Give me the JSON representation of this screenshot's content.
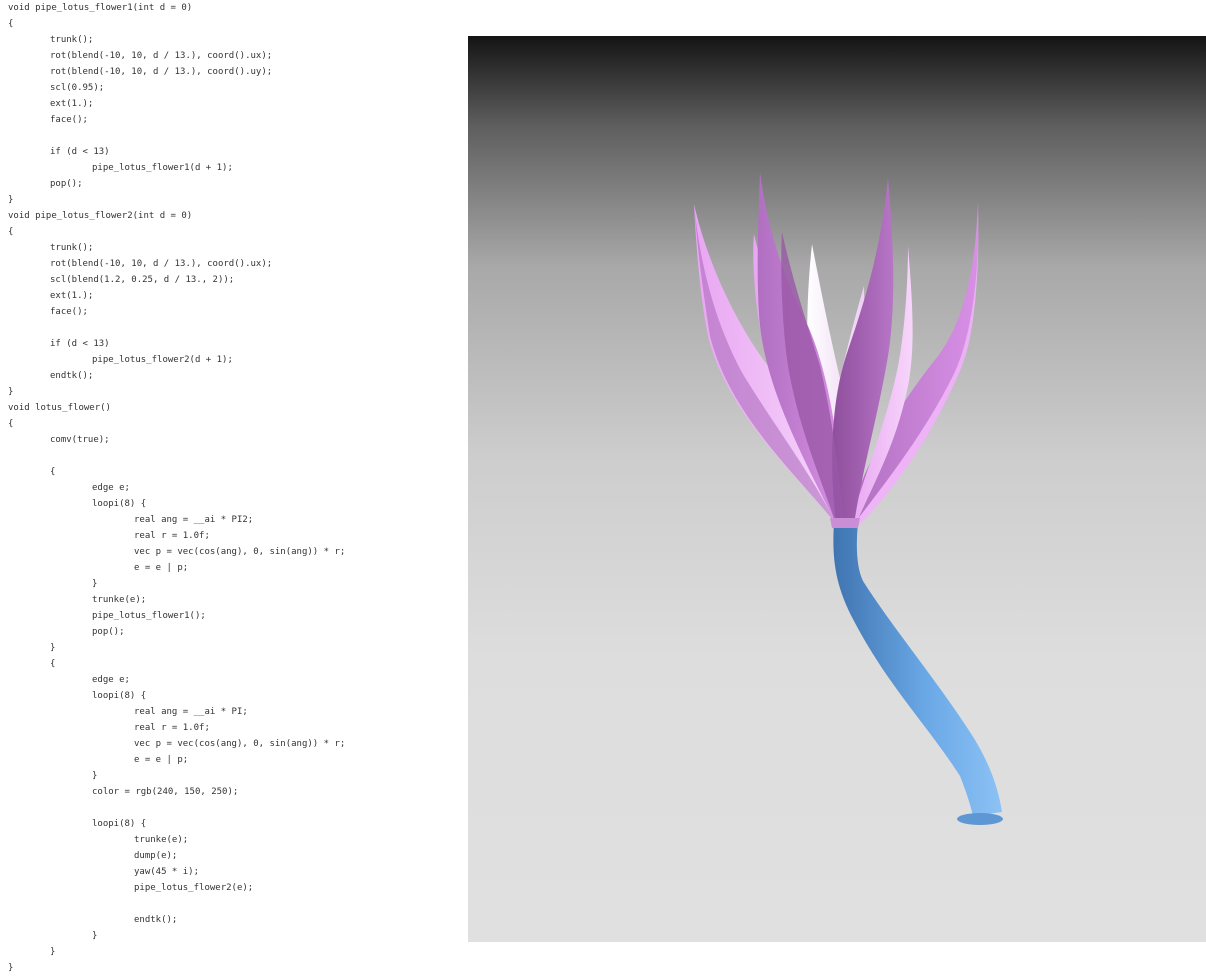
{
  "code_lines": [
    {
      "indent": 0,
      "text": "void pipe_lotus_flower1(int d = 0)"
    },
    {
      "indent": 0,
      "text": "{"
    },
    {
      "indent": 1,
      "text": "trunk();"
    },
    {
      "indent": 1,
      "text": "rot(blend(-10, 10, d / 13.), coord().ux);"
    },
    {
      "indent": 1,
      "text": "rot(blend(-10, 10, d / 13.), coord().uy);"
    },
    {
      "indent": 1,
      "text": "scl(0.95);"
    },
    {
      "indent": 1,
      "text": "ext(1.);"
    },
    {
      "indent": 1,
      "text": "face();"
    },
    {
      "indent": 1,
      "text": ""
    },
    {
      "indent": 1,
      "text": "if (d < 13)"
    },
    {
      "indent": 2,
      "text": "pipe_lotus_flower1(d + 1);"
    },
    {
      "indent": 1,
      "text": "pop();"
    },
    {
      "indent": 0,
      "text": "}"
    },
    {
      "indent": 0,
      "text": "void pipe_lotus_flower2(int d = 0)"
    },
    {
      "indent": 0,
      "text": "{"
    },
    {
      "indent": 1,
      "text": "trunk();"
    },
    {
      "indent": 1,
      "text": "rot(blend(-10, 10, d / 13.), coord().ux);"
    },
    {
      "indent": 1,
      "text": "scl(blend(1.2, 0.25, d / 13., 2));"
    },
    {
      "indent": 1,
      "text": "ext(1.);"
    },
    {
      "indent": 1,
      "text": "face();"
    },
    {
      "indent": 1,
      "text": ""
    },
    {
      "indent": 1,
      "text": "if (d < 13)"
    },
    {
      "indent": 2,
      "text": "pipe_lotus_flower2(d + 1);"
    },
    {
      "indent": 1,
      "text": "endtk();"
    },
    {
      "indent": 0,
      "text": "}"
    },
    {
      "indent": 0,
      "text": "void lotus_flower()"
    },
    {
      "indent": 0,
      "text": "{"
    },
    {
      "indent": 1,
      "text": "comv(true);"
    },
    {
      "indent": 1,
      "text": ""
    },
    {
      "indent": 1,
      "text": "{"
    },
    {
      "indent": 2,
      "text": "edge e;"
    },
    {
      "indent": 2,
      "text": "loopi(8) {"
    },
    {
      "indent": 3,
      "text": "real ang = __ai * PI2;"
    },
    {
      "indent": 3,
      "text": "real r = 1.0f;"
    },
    {
      "indent": 3,
      "text": "vec p = vec(cos(ang), 0, sin(ang)) * r;"
    },
    {
      "indent": 3,
      "text": "e = e | p;"
    },
    {
      "indent": 2,
      "text": "}"
    },
    {
      "indent": 2,
      "text": "trunke(e);"
    },
    {
      "indent": 2,
      "text": "pipe_lotus_flower1();"
    },
    {
      "indent": 2,
      "text": "pop();"
    },
    {
      "indent": 1,
      "text": "}"
    },
    {
      "indent": 1,
      "text": "{"
    },
    {
      "indent": 2,
      "text": "edge e;"
    },
    {
      "indent": 2,
      "text": "loopi(8) {"
    },
    {
      "indent": 3,
      "text": "real ang = __ai * PI;"
    },
    {
      "indent": 3,
      "text": "real r = 1.0f;"
    },
    {
      "indent": 3,
      "text": "vec p = vec(cos(ang), 0, sin(ang)) * r;"
    },
    {
      "indent": 3,
      "text": "e = e | p;"
    },
    {
      "indent": 2,
      "text": "}"
    },
    {
      "indent": 2,
      "text": "color = rgb(240, 150, 250);"
    },
    {
      "indent": 2,
      "text": ""
    },
    {
      "indent": 2,
      "text": "loopi(8) {"
    },
    {
      "indent": 3,
      "text": "trunke(e);"
    },
    {
      "indent": 3,
      "text": "dump(e);"
    },
    {
      "indent": 3,
      "text": "yaw(45 * i);"
    },
    {
      "indent": 3,
      "text": "pipe_lotus_flower2(e);"
    },
    {
      "indent": 3,
      "text": ""
    },
    {
      "indent": 3,
      "text": "endtk();"
    },
    {
      "indent": 2,
      "text": "}"
    },
    {
      "indent": 1,
      "text": "}"
    },
    {
      "indent": 0,
      "text": "}"
    }
  ],
  "render": {
    "stem_color": "#6aa8e6",
    "petal_color": "#c77fd6",
    "petal_light_color": "#f0a0fa",
    "background_top": "#141414",
    "background_bottom": "#e0e0e0"
  }
}
